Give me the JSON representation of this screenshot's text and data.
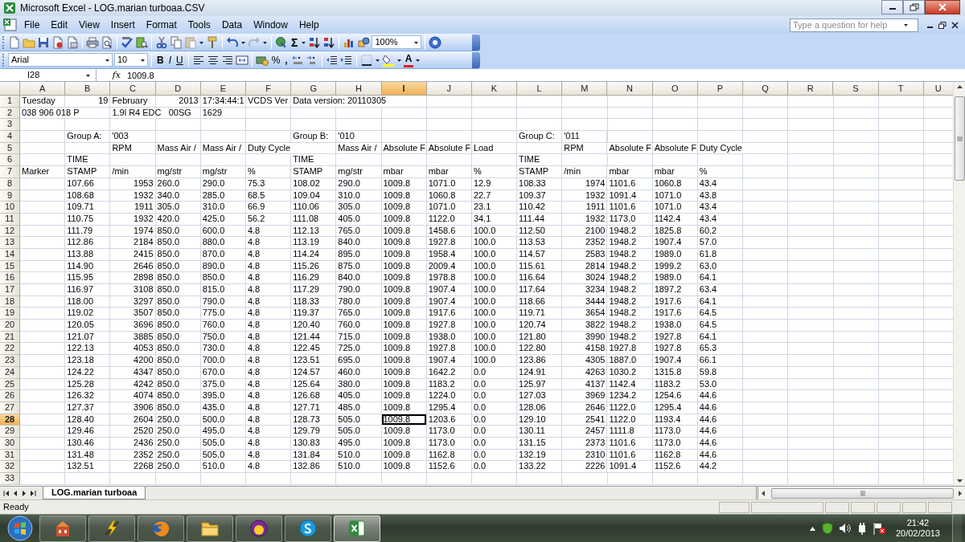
{
  "window": {
    "title": "Microsoft Excel - LOG.marian turboaa.CSV"
  },
  "menu": [
    "File",
    "Edit",
    "View",
    "Insert",
    "Format",
    "Tools",
    "Data",
    "Window",
    "Help"
  ],
  "help_search": {
    "placeholder": "Type a question for help"
  },
  "standard_toolbar": {
    "autosum": "Σ",
    "zoom": "100%"
  },
  "formatting_toolbar": {
    "font": "Arial",
    "size": "10",
    "bold": "B",
    "italic": "I",
    "underline": "U",
    "percent": "%",
    "comma": ",",
    "font_color": "A"
  },
  "formula_bar": {
    "name_box": "I28",
    "insert_function": "fx",
    "formula": "1009.8"
  },
  "columns": [
    {
      "label": "A",
      "selected": false
    },
    {
      "label": "B",
      "selected": false
    },
    {
      "label": "C",
      "selected": false
    },
    {
      "label": "D",
      "selected": false
    },
    {
      "label": "E",
      "selected": false
    },
    {
      "label": "F",
      "selected": false
    },
    {
      "label": "G",
      "selected": false
    },
    {
      "label": "H",
      "selected": false
    },
    {
      "label": "I",
      "selected": true
    },
    {
      "label": "J",
      "selected": false
    },
    {
      "label": "K",
      "selected": false
    },
    {
      "label": "L",
      "selected": false
    },
    {
      "label": "M",
      "selected": false
    },
    {
      "label": "N",
      "selected": false
    },
    {
      "label": "O",
      "selected": false
    },
    {
      "label": "P",
      "selected": false
    },
    {
      "label": "Q",
      "selected": false
    },
    {
      "label": "R",
      "selected": false
    },
    {
      "label": "S",
      "selected": false
    },
    {
      "label": "T",
      "selected": false
    },
    {
      "label": "U",
      "selected": false
    }
  ],
  "rows": [
    {
      "label": "1",
      "selected": false,
      "right_aligned": {
        "B": true,
        "D": true
      },
      "cells": {
        "A": "Tuesday",
        "B": "19",
        "C": "February",
        "D": "2013",
        "E": "17:34:44:1",
        "F": "VCDS Ver",
        "G": "Data version: 20110305"
      }
    },
    {
      "label": "2",
      "selected": false,
      "cells": {
        "A": "038 906 018 P",
        "C": "1.9l R4 EDC   00SG",
        "E": "1629"
      }
    },
    {
      "label": "3",
      "selected": false
    },
    {
      "label": "4",
      "selected": false,
      "cells": {
        "B": "Group A:",
        "C": "'003",
        "G": "Group B:",
        "H": "'010",
        "L": "Group C:",
        "M": "'011"
      }
    },
    {
      "label": "5",
      "selected": false,
      "cells": {
        "C": "RPM",
        "D": "Mass Air /",
        "E": "Mass Air /",
        "F": "Duty Cycle",
        "H": "Mass Air /",
        "I": "Absolute F",
        "J": "Absolute F",
        "K": "Load",
        "M": "RPM",
        "N": "Absolute F",
        "O": "Absolute F",
        "P": "Duty Cycle"
      }
    },
    {
      "label": "6",
      "selected": false,
      "cells": {
        "B": "TIME",
        "G": "TIME",
        "L": "TIME"
      }
    },
    {
      "label": "7",
      "selected": false,
      "cells": {
        "A": "Marker",
        "B": "STAMP",
        "C": "/min",
        "D": "mg/str",
        "E": "mg/str",
        "F": "%",
        "G": "STAMP",
        "H": "mg/str",
        "I": "mbar",
        "J": "mbar",
        "K": "%",
        "L": "STAMP",
        "M": "/min",
        "N": "mbar",
        "O": "mbar",
        "P": "%"
      }
    },
    {
      "label": "8",
      "selected": false,
      "right_aligned": {
        "C": true,
        "M": true
      },
      "cells": {
        "B": "107.66",
        "C": "1953",
        "D": "260.0",
        "E": "290.0",
        "F": "75.3",
        "G": "108.02",
        "H": "290.0",
        "I": "1009.8",
        "J": "1071.0",
        "K": "12.9",
        "L": "108.33",
        "M": "1974",
        "N": "1101.6",
        "O": "1060.8",
        "P": "43.4"
      }
    },
    {
      "label": "9",
      "selected": false,
      "right_aligned": {
        "C": true,
        "M": true
      },
      "cells": {
        "B": "108.68",
        "C": "1932",
        "D": "340.0",
        "E": "285.0",
        "F": "68.5",
        "G": "109.04",
        "H": "310.0",
        "I": "1009.8",
        "J": "1060.8",
        "K": "22.7",
        "L": "109.37",
        "M": "1932",
        "N": "1091.4",
        "O": "1071.0",
        "P": "43.8"
      }
    },
    {
      "label": "10",
      "selected": false,
      "right_aligned": {
        "C": true,
        "M": true
      },
      "cells": {
        "B": "109.71",
        "C": "1911",
        "D": "305.0",
        "E": "310.0",
        "F": "66.9",
        "G": "110.06",
        "H": "305.0",
        "I": "1009.8",
        "J": "1071.0",
        "K": "23.1",
        "L": "110.42",
        "M": "1911",
        "N": "1101.6",
        "O": "1071.0",
        "P": "43.4"
      }
    },
    {
      "label": "11",
      "selected": false,
      "right_aligned": {
        "C": true,
        "M": true
      },
      "cells": {
        "B": "110.75",
        "C": "1932",
        "D": "420.0",
        "E": "425.0",
        "F": "56.2",
        "G": "111.08",
        "H": "405.0",
        "I": "1009.8",
        "J": "1122.0",
        "K": "34.1",
        "L": "111.44",
        "M": "1932",
        "N": "1173.0",
        "O": "1142.4",
        "P": "43.4"
      }
    },
    {
      "label": "12",
      "selected": false,
      "right_aligned": {
        "C": true,
        "M": true
      },
      "cells": {
        "B": "111.79",
        "C": "1974",
        "D": "850.0",
        "E": "600.0",
        "F": "4.8",
        "G": "112.13",
        "H": "765.0",
        "I": "1009.8",
        "J": "1458.6",
        "K": "100.0",
        "L": "112.50",
        "M": "2100",
        "N": "1948.2",
        "O": "1825.8",
        "P": "60.2"
      }
    },
    {
      "label": "13",
      "selected": false,
      "right_aligned": {
        "C": true,
        "M": true
      },
      "cells": {
        "B": "112.86",
        "C": "2184",
        "D": "850.0",
        "E": "880.0",
        "F": "4.8",
        "G": "113.19",
        "H": "840.0",
        "I": "1009.8",
        "J": "1927.8",
        "K": "100.0",
        "L": "113.53",
        "M": "2352",
        "N": "1948.2",
        "O": "1907.4",
        "P": "57.0"
      }
    },
    {
      "label": "14",
      "selected": false,
      "right_aligned": {
        "C": true,
        "M": true
      },
      "cells": {
        "B": "113.88",
        "C": "2415",
        "D": "850.0",
        "E": "870.0",
        "F": "4.8",
        "G": "114.24",
        "H": "895.0",
        "I": "1009.8",
        "J": "1958.4",
        "K": "100.0",
        "L": "114.57",
        "M": "2583",
        "N": "1948.2",
        "O": "1989.0",
        "P": "61.8"
      }
    },
    {
      "label": "15",
      "selected": false,
      "right_aligned": {
        "C": true,
        "M": true
      },
      "cells": {
        "B": "114.90",
        "C": "2646",
        "D": "850.0",
        "E": "890.0",
        "F": "4.8",
        "G": "115.26",
        "H": "875.0",
        "I": "1009.8",
        "J": "2009.4",
        "K": "100.0",
        "L": "115.61",
        "M": "2814",
        "N": "1948.2",
        "O": "1999.2",
        "P": "63.0"
      }
    },
    {
      "label": "16",
      "selected": false,
      "right_aligned": {
        "C": true,
        "M": true
      },
      "cells": {
        "B": "115.95",
        "C": "2898",
        "D": "850.0",
        "E": "850.0",
        "F": "4.8",
        "G": "116.29",
        "H": "840.0",
        "I": "1009.8",
        "J": "1978.8",
        "K": "100.0",
        "L": "116.64",
        "M": "3024",
        "N": "1948.2",
        "O": "1989.0",
        "P": "64.1"
      }
    },
    {
      "label": "17",
      "selected": false,
      "right_aligned": {
        "C": true,
        "M": true
      },
      "cells": {
        "B": "116.97",
        "C": "3108",
        "D": "850.0",
        "E": "815.0",
        "F": "4.8",
        "G": "117.29",
        "H": "790.0",
        "I": "1009.8",
        "J": "1907.4",
        "K": "100.0",
        "L": "117.64",
        "M": "3234",
        "N": "1948.2",
        "O": "1897.2",
        "P": "63.4"
      }
    },
    {
      "label": "18",
      "selected": false,
      "right_aligned": {
        "C": true,
        "M": true
      },
      "cells": {
        "B": "118.00",
        "C": "3297",
        "D": "850.0",
        "E": "790.0",
        "F": "4.8",
        "G": "118.33",
        "H": "780.0",
        "I": "1009.8",
        "J": "1907.4",
        "K": "100.0",
        "L": "118.66",
        "M": "3444",
        "N": "1948.2",
        "O": "1917.6",
        "P": "64.1"
      }
    },
    {
      "label": "19",
      "selected": false,
      "right_aligned": {
        "C": true,
        "M": true
      },
      "cells": {
        "B": "119.02",
        "C": "3507",
        "D": "850.0",
        "E": "775.0",
        "F": "4.8",
        "G": "119.37",
        "H": "765.0",
        "I": "1009.8",
        "J": "1917.6",
        "K": "100.0",
        "L": "119.71",
        "M": "3654",
        "N": "1948.2",
        "O": "1917.6",
        "P": "64.5"
      }
    },
    {
      "label": "20",
      "selected": false,
      "right_aligned": {
        "C": true,
        "M": true
      },
      "cells": {
        "B": "120.05",
        "C": "3696",
        "D": "850.0",
        "E": "760.0",
        "F": "4.8",
        "G": "120.40",
        "H": "760.0",
        "I": "1009.8",
        "J": "1927.8",
        "K": "100.0",
        "L": "120.74",
        "M": "3822",
        "N": "1948.2",
        "O": "1938.0",
        "P": "64.5"
      }
    },
    {
      "label": "21",
      "selected": false,
      "right_aligned": {
        "C": true,
        "M": true
      },
      "cells": {
        "B": "121.07",
        "C": "3885",
        "D": "850.0",
        "E": "750.0",
        "F": "4.8",
        "G": "121.44",
        "H": "715.0",
        "I": "1009.8",
        "J": "1938.0",
        "K": "100.0",
        "L": "121.80",
        "M": "3990",
        "N": "1948.2",
        "O": "1927.8",
        "P": "64.1"
      }
    },
    {
      "label": "22",
      "selected": false,
      "right_aligned": {
        "C": true,
        "M": true
      },
      "cells": {
        "B": "122.13",
        "C": "4053",
        "D": "850.0",
        "E": "730.0",
        "F": "4.8",
        "G": "122.45",
        "H": "725.0",
        "I": "1009.8",
        "J": "1927.8",
        "K": "100.0",
        "L": "122.80",
        "M": "4158",
        "N": "1927.8",
        "O": "1927.8",
        "P": "65.3"
      }
    },
    {
      "label": "23",
      "selected": false,
      "right_aligned": {
        "C": true,
        "M": true
      },
      "cells": {
        "B": "123.18",
        "C": "4200",
        "D": "850.0",
        "E": "700.0",
        "F": "4.8",
        "G": "123.51",
        "H": "695.0",
        "I": "1009.8",
        "J": "1907.4",
        "K": "100.0",
        "L": "123.86",
        "M": "4305",
        "N": "1887.0",
        "O": "1907.4",
        "P": "66.1"
      }
    },
    {
      "label": "24",
      "selected": false,
      "right_aligned": {
        "C": true,
        "M": true
      },
      "cells": {
        "B": "124.22",
        "C": "4347",
        "D": "850.0",
        "E": "670.0",
        "F": "4.8",
        "G": "124.57",
        "H": "460.0",
        "I": "1009.8",
        "J": "1642.2",
        "K": "0.0",
        "L": "124.91",
        "M": "4263",
        "N": "1030.2",
        "O": "1315.8",
        "P": "59.8"
      }
    },
    {
      "label": "25",
      "selected": false,
      "right_aligned": {
        "C": true,
        "M": true
      },
      "cells": {
        "B": "125.28",
        "C": "4242",
        "D": "850.0",
        "E": "375.0",
        "F": "4.8",
        "G": "125.64",
        "H": "380.0",
        "I": "1009.8",
        "J": "1183.2",
        "K": "0.0",
        "L": "125.97",
        "M": "4137",
        "N": "1142.4",
        "O": "1183.2",
        "P": "53.0"
      }
    },
    {
      "label": "26",
      "selected": false,
      "right_aligned": {
        "C": true,
        "M": true
      },
      "cells": {
        "B": "126.32",
        "C": "4074",
        "D": "850.0",
        "E": "395.0",
        "F": "4.8",
        "G": "126.68",
        "H": "405.0",
        "I": "1009.8",
        "J": "1224.0",
        "K": "0.0",
        "L": "127.03",
        "M": "3969",
        "N": "1234.2",
        "O": "1254.6",
        "P": "44.6"
      }
    },
    {
      "label": "27",
      "selected": false,
      "right_aligned": {
        "C": true,
        "M": true
      },
      "cells": {
        "B": "127.37",
        "C": "3906",
        "D": "850.0",
        "E": "435.0",
        "F": "4.8",
        "G": "127.71",
        "H": "485.0",
        "I": "1009.8",
        "J": "1295.4",
        "K": "0.0",
        "L": "128.06",
        "M": "2646",
        "N": "1122.0",
        "O": "1295.4",
        "P": "44.6"
      }
    },
    {
      "label": "28",
      "selected": true,
      "active_cells": {
        "I": true
      },
      "right_aligned": {
        "C": true,
        "M": true
      },
      "cells": {
        "B": "128.40",
        "C": "2604",
        "D": "250.0",
        "E": "500.0",
        "F": "4.8",
        "G": "128.73",
        "H": "505.0",
        "I": "1009.8",
        "J": "1203.6",
        "K": "0.0",
        "L": "129.10",
        "M": "2541",
        "N": "1122.0",
        "O": "1193.4",
        "P": "44.6"
      }
    },
    {
      "label": "29",
      "selected": false,
      "right_aligned": {
        "C": true,
        "M": true
      },
      "cells": {
        "B": "129.46",
        "C": "2520",
        "D": "250.0",
        "E": "495.0",
        "F": "4.8",
        "G": "129.79",
        "H": "505.0",
        "I": "1009.8",
        "J": "1173.0",
        "K": "0.0",
        "L": "130.11",
        "M": "2457",
        "N": "1111.8",
        "O": "1173.0",
        "P": "44.6"
      }
    },
    {
      "label": "30",
      "selected": false,
      "right_aligned": {
        "C": true,
        "M": true
      },
      "cells": {
        "B": "130.46",
        "C": "2436",
        "D": "250.0",
        "E": "505.0",
        "F": "4.8",
        "G": "130.83",
        "H": "495.0",
        "I": "1009.8",
        "J": "1173.0",
        "K": "0.0",
        "L": "131.15",
        "M": "2373",
        "N": "1101.6",
        "O": "1173.0",
        "P": "44.6"
      }
    },
    {
      "label": "31",
      "selected": false,
      "right_aligned": {
        "C": true,
        "M": true
      },
      "cells": {
        "B": "131.48",
        "C": "2352",
        "D": "250.0",
        "E": "505.0",
        "F": "4.8",
        "G": "131.84",
        "H": "510.0",
        "I": "1009.8",
        "J": "1162.8",
        "K": "0.0",
        "L": "132.19",
        "M": "2310",
        "N": "1101.6",
        "O": "1162.8",
        "P": "44.6"
      }
    },
    {
      "label": "32",
      "selected": false,
      "right_aligned": {
        "C": true,
        "M": true
      },
      "cells": {
        "B": "132.51",
        "C": "2268",
        "D": "250.0",
        "E": "510.0",
        "F": "4.8",
        "G": "132.86",
        "H": "510.0",
        "I": "1009.8",
        "J": "1152.6",
        "K": "0.0",
        "L": "133.22",
        "M": "2226",
        "N": "1091.4",
        "O": "1152.6",
        "P": "44.2"
      }
    },
    {
      "label": "33",
      "selected": false
    }
  ],
  "sheet_tabs": [
    {
      "label": "LOG.marian turboaa",
      "selected": true
    }
  ],
  "status_bar": {
    "text": "Ready"
  },
  "taskbar": {
    "buttons": [
      {
        "active": false
      },
      {
        "active": false
      },
      {
        "active": false
      },
      {
        "active": false
      },
      {
        "active": false
      },
      {
        "active": false
      },
      {
        "active": true
      }
    ],
    "time": "21:42",
    "date": "20/02/2013"
  }
}
